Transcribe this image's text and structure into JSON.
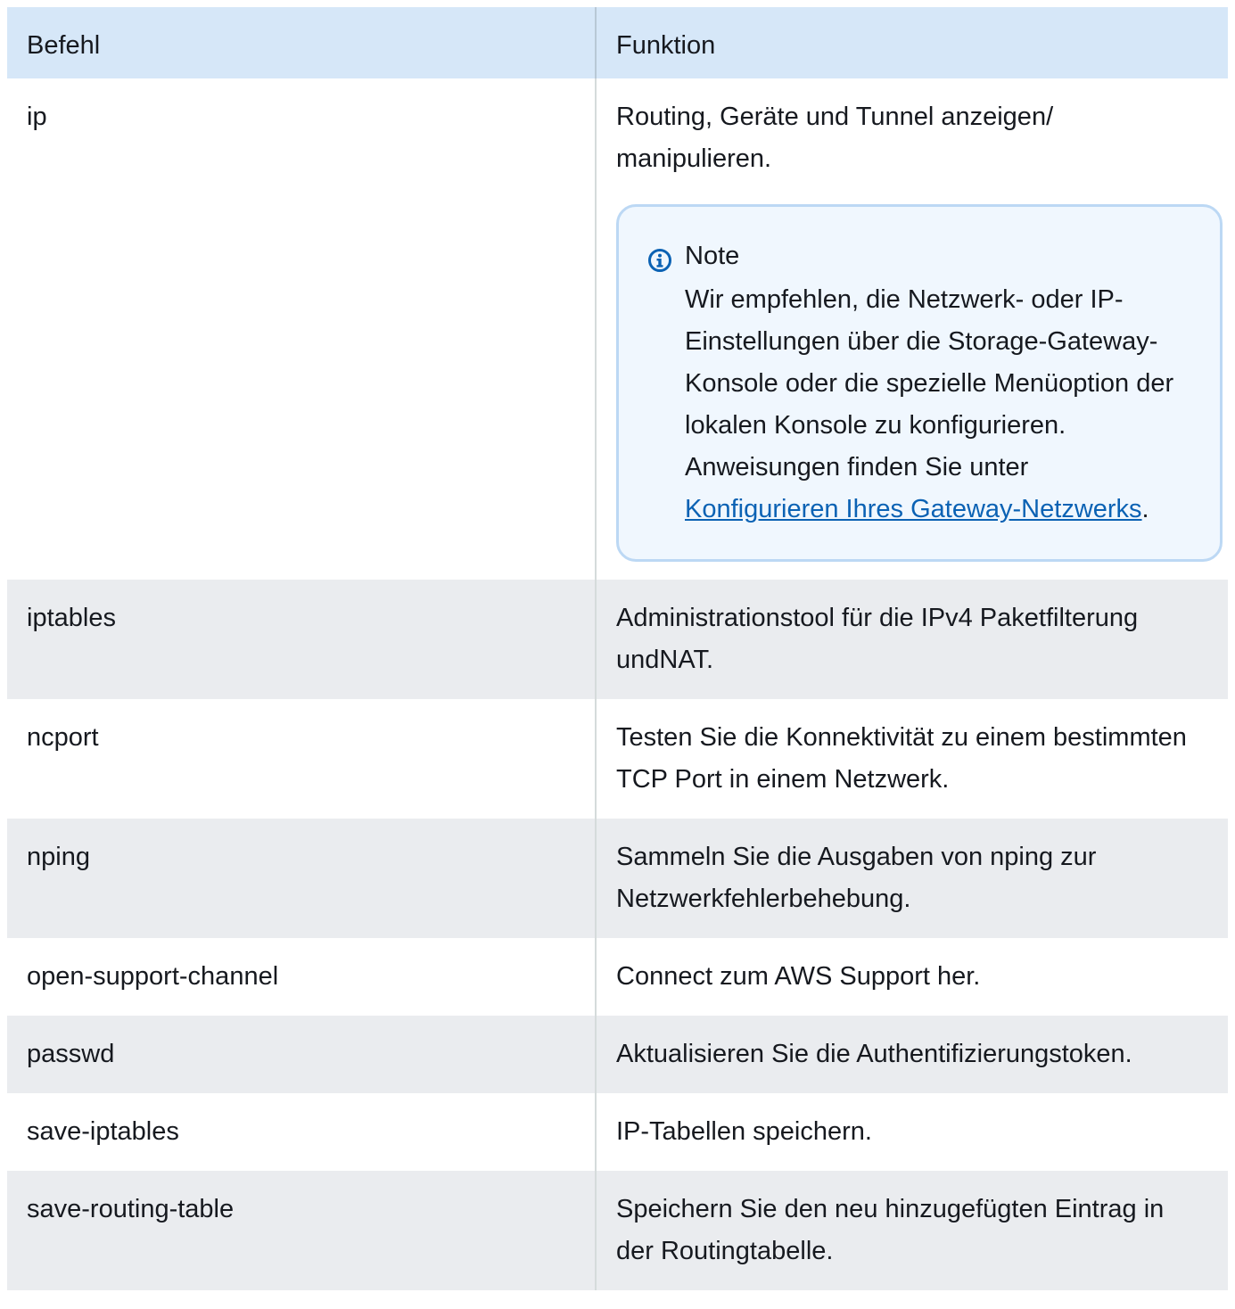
{
  "table": {
    "headers": [
      "Befehl",
      "Funktion"
    ],
    "rows": [
      {
        "command": "ip",
        "function": "Routing, Geräte und Tunnel anzeigen/ manipulieren."
      },
      {
        "command": "iptables",
        "function": "Administrationstool für die IPv4 Paketfilterung undNAT."
      },
      {
        "command": "ncport",
        "function": "Testen Sie die Konnektivität zu einem bestimmten TCP Port in einem Netzwerk."
      },
      {
        "command": "nping",
        "function": "Sammeln Sie die Ausgaben von nping zur Netzwerkfehlerbehebung."
      },
      {
        "command": "open-support-channel",
        "function": "Connect zum AWS Support her."
      },
      {
        "command": "passwd",
        "function": "Aktualisieren Sie die Authentifizierungstoken."
      },
      {
        "command": "save-iptables",
        "function": "IP-Tabellen speichern."
      },
      {
        "command": "save-routing-table",
        "function": "Speichern Sie den neu hinzugefügten Eintrag in der Routingtabelle."
      }
    ]
  },
  "note": {
    "icon": "info-icon",
    "title": "Note",
    "text_before": "Wir empfehlen, die Netzwerk- oder IP-Einstellungen über die Storage-Gateway-Konsole oder die spezielle Menüoption der lokalen Konsole zu konfigurieren. Anweisungen finden Sie unter ",
    "link_text": "Konfigurieren Ihres Gateway-Netzwerks",
    "text_after": "."
  },
  "colors": {
    "header_bg": "#d6e7f8",
    "stripe_bg": "#eaecef",
    "note_bg": "#f0f7fe",
    "note_border": "#bcd8f4",
    "link": "#0b62b4",
    "info_icon": "#0b62b4"
  }
}
